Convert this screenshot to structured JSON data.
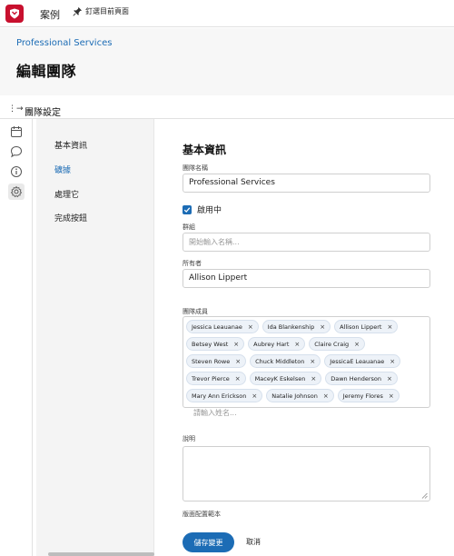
{
  "topbar": {
    "cases_label": "案例",
    "pin_label": "釘選目前頁面"
  },
  "header": {
    "breadcrumb": "Professional Services",
    "title": "編輯團隊"
  },
  "settings_bar": {
    "label": "團隊設定"
  },
  "nav": {
    "items": [
      {
        "label": "基本資訊",
        "active": false
      },
      {
        "label": "礦據",
        "active": true
      },
      {
        "label": "處理它",
        "active": false
      },
      {
        "label": "完成按鈕",
        "active": false
      }
    ]
  },
  "form": {
    "section_title": "基本資訊",
    "team_name_label": "團隊名稱",
    "team_name_value": "Professional Services",
    "active_label": "啟用中",
    "active_checked": true,
    "group_label": "群組",
    "group_placeholder": "開始輸入名稱...",
    "owner_label": "所有者",
    "owner_value": "Allison Lippert",
    "members_label": "團隊成員",
    "members": [
      "Jessica Leauanae",
      "Ida Blankenship",
      "Allison Lippert",
      "Betsey West",
      "Aubrey Hart",
      "Claire Craig",
      "Steven Rowe",
      "Chuck Middleton",
      "JessicaE Leauanae",
      "Trevor Pierce",
      "MaceyK Eskelsen",
      "Dawn Henderson",
      "Mary  Ann Erickson",
      "Natalie Johnson",
      "Jeremy Flores"
    ],
    "members_placeholder": "請輸入姓名...",
    "description_label": "說明",
    "layout_template_label": "版面配置範本",
    "save_label": "儲存變更",
    "cancel_label": "取消"
  },
  "colors": {
    "accent": "#1c6cb5",
    "brand": "#c8102e"
  }
}
